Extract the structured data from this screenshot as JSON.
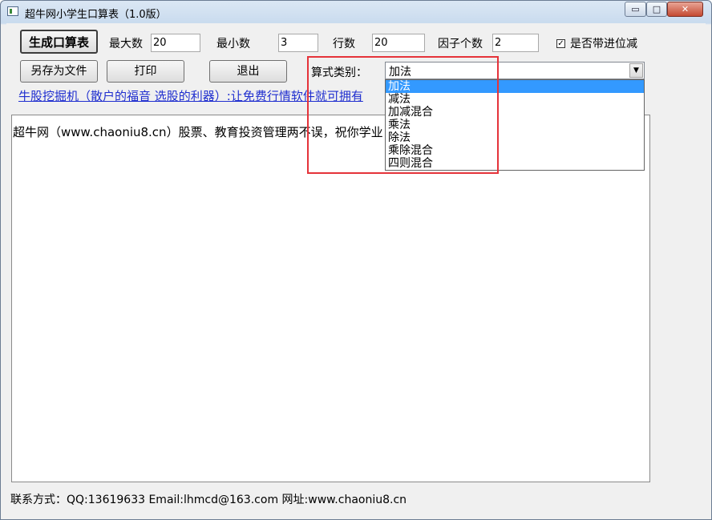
{
  "window": {
    "title": "超牛网小学生口算表（1.0版）",
    "minimize_glyph": "▭",
    "maximize_glyph": "□",
    "close_glyph": "✕"
  },
  "toolbar": {
    "generate_label": "生成口算表",
    "save_label": "另存为文件",
    "print_label": "打印",
    "exit_label": "退出"
  },
  "params": {
    "max_label": "最大数",
    "max_value": "20",
    "min_label": "最小数",
    "min_value": "3",
    "rows_label": "行数",
    "rows_value": "20",
    "factors_label": "因子个数",
    "factors_value": "2",
    "carry_label": "是否带进位减",
    "carry_checked": true,
    "carry_glyph": "✓"
  },
  "formula": {
    "label": "算式类别：",
    "selected": "加法",
    "arrow_glyph": "▼",
    "options": [
      "加法",
      "减法",
      "加减混合",
      "乘法",
      "除法",
      "乘除混合",
      "四则混合"
    ]
  },
  "ad_link": "牛股挖掘机（散户的福音 选股的利器）:让免费行情软件就可拥有",
  "content": {
    "line": "超牛网（www.chaoniu8.cn）股票、教育投资管理两不误，祝你学业"
  },
  "footer": {
    "text": "联系方式：QQ:13619633  Email:lhmcd@163.com 网址:www.chaoniu8.cn"
  },
  "colors": {
    "highlight": "#e5333a",
    "selection": "#3399ff",
    "link": "#1f2ecf"
  }
}
